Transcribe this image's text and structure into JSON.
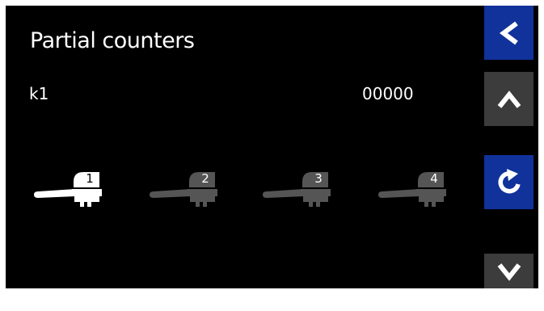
{
  "header": {
    "title": "Partial counters"
  },
  "counter": {
    "label": "k1",
    "value": "00000"
  },
  "groups": [
    {
      "number": "1",
      "state": "selected"
    },
    {
      "number": "2",
      "state": "unselected"
    },
    {
      "number": "3",
      "state": "unselected"
    },
    {
      "number": "4",
      "state": "unselected"
    }
  ],
  "sidebar": {
    "buttons": [
      "back-icon",
      "chevron-up-icon",
      "refresh-icon",
      "chevron-down-icon"
    ]
  },
  "colors": {
    "background": "#000000",
    "accent_blue": "#10329a",
    "button_gray": "#3c3c3c",
    "active": "#ffffff",
    "inactive": "#555555"
  }
}
